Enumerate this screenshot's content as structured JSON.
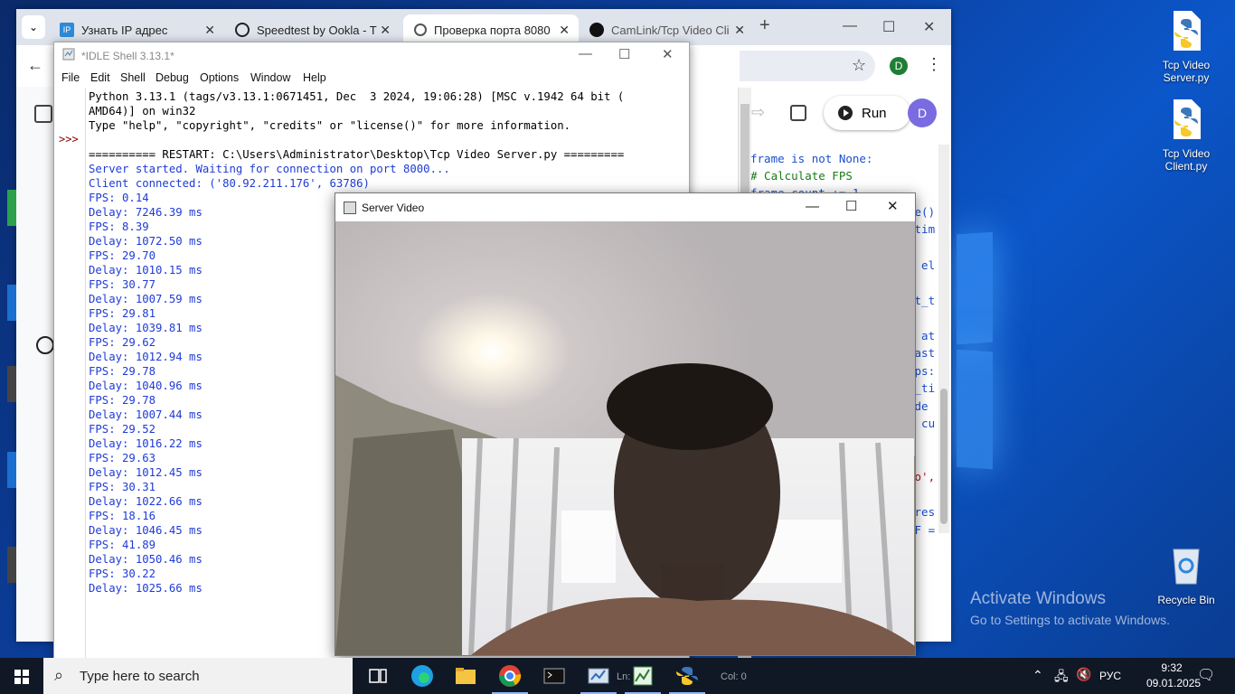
{
  "browser": {
    "tabs": [
      {
        "title": "Узнать IP адрес",
        "favicon": "ip-icon",
        "active": false
      },
      {
        "title": "Speedtest by Ookla - T",
        "favicon": "speedtest-icon",
        "active": false
      },
      {
        "title": "Проверка порта 8080",
        "favicon": "globe-icon",
        "active": true
      },
      {
        "title": "CamLink/Tcp Video Cli",
        "favicon": "github-icon",
        "active": false
      }
    ],
    "new_tab": "+",
    "profile_initial": "D",
    "run_label": "Run",
    "user_initial": "D",
    "code_lines": [
      {
        "text": "frame is not None:",
        "color": "#1a4fd1"
      },
      {
        "text": " # Calculate FPS",
        "color": "#1a7a1a"
      },
      {
        "text": "  frame_count += 1",
        "color": "#1a4fd1"
      },
      {
        "text": "ne()",
        "color": "#1a4fd1"
      },
      {
        "text": "_tim",
        "color": "#1a4fd1"
      },
      {
        "text": "/ el",
        "color": "#1a4fd1"
      },
      {
        "text": "nt_t",
        "color": "#1a4fd1"
      },
      {
        "text": "y at",
        "color": "#1a4fd1"
      },
      {
        "text": "last",
        "color": "#1a4fd1"
      },
      {
        "text": "fps:",
        "color": "#1a4fd1"
      },
      {
        "text": "d_ti",
        "color": "#1a4fd1"
      },
      {
        "text": "{de",
        "color": "#1a4fd1"
      },
      {
        "text": "= cu",
        "color": "#1a4fd1"
      },
      {
        "text": "eo',",
        "color": "#a3151d"
      },
      {
        "text": "pres",
        "color": "#1a4fd1"
      },
      {
        "text": "FF =",
        "color": "#1a4fd1"
      }
    ]
  },
  "idle": {
    "title": "*IDLE Shell 3.13.1*",
    "menu": [
      "File",
      "Edit",
      "Shell",
      "Debug",
      "Options",
      "Window",
      "Help"
    ],
    "prompt": ">>>",
    "lines": [
      {
        "text": "Python 3.13.1 (tags/v3.13.1:0671451, Dec  3 2024, 19:06:28) [MSC v.1942 64 bit (",
        "color": "#000000"
      },
      {
        "text": "AMD64)] on win32",
        "color": "#000000"
      },
      {
        "text": "Type \"help\", \"copyright\", \"credits\" or \"license()\" for more information.",
        "color": "#000000"
      },
      {
        "text": "",
        "color": "#000000"
      },
      {
        "text": "========== RESTART: C:\\Users\\Administrator\\Desktop\\Tcp Video Server.py =========",
        "color": "#000000"
      },
      {
        "text": "Server started. Waiting for connection on port 8000...",
        "color": "#1f3bd6"
      },
      {
        "text": "Client connected: ('80.92.211.176', 63786)",
        "color": "#1f3bd6"
      },
      {
        "text": "FPS: 0.14",
        "color": "#1f3bd6"
      },
      {
        "text": "Delay: 7246.39 ms",
        "color": "#1f3bd6"
      },
      {
        "text": "FPS: 8.39",
        "color": "#1f3bd6"
      },
      {
        "text": "Delay: 1072.50 ms",
        "color": "#1f3bd6"
      },
      {
        "text": "FPS: 29.70",
        "color": "#1f3bd6"
      },
      {
        "text": "Delay: 1010.15 ms",
        "color": "#1f3bd6"
      },
      {
        "text": "FPS: 30.77",
        "color": "#1f3bd6"
      },
      {
        "text": "Delay: 1007.59 ms",
        "color": "#1f3bd6"
      },
      {
        "text": "FPS: 29.81",
        "color": "#1f3bd6"
      },
      {
        "text": "Delay: 1039.81 ms",
        "color": "#1f3bd6"
      },
      {
        "text": "FPS: 29.62",
        "color": "#1f3bd6"
      },
      {
        "text": "Delay: 1012.94 ms",
        "color": "#1f3bd6"
      },
      {
        "text": "FPS: 29.78",
        "color": "#1f3bd6"
      },
      {
        "text": "Delay: 1040.96 ms",
        "color": "#1f3bd6"
      },
      {
        "text": "FPS: 29.78",
        "color": "#1f3bd6"
      },
      {
        "text": "Delay: 1007.44 ms",
        "color": "#1f3bd6"
      },
      {
        "text": "FPS: 29.52",
        "color": "#1f3bd6"
      },
      {
        "text": "Delay: 1016.22 ms",
        "color": "#1f3bd6"
      },
      {
        "text": "FPS: 29.63",
        "color": "#1f3bd6"
      },
      {
        "text": "Delay: 1012.45 ms",
        "color": "#1f3bd6"
      },
      {
        "text": "FPS: 30.31",
        "color": "#1f3bd6"
      },
      {
        "text": "Delay: 1022.66 ms",
        "color": "#1f3bd6"
      },
      {
        "text": "FPS: 18.16",
        "color": "#1f3bd6"
      },
      {
        "text": "Delay: 1046.45 ms",
        "color": "#1f3bd6"
      },
      {
        "text": "FPS: 41.89",
        "color": "#1f3bd6"
      },
      {
        "text": "Delay: 1050.46 ms",
        "color": "#1f3bd6"
      },
      {
        "text": "FPS: 30.22",
        "color": "#1f3bd6"
      },
      {
        "text": "Delay: 1025.66 ms",
        "color": "#1f3bd6"
      }
    ],
    "status_ln": "Ln:",
    "status_col": "Col: 0"
  },
  "video": {
    "title": "Server Video"
  },
  "desktop": {
    "icons": [
      {
        "label": "Tcp Video Server.py",
        "icon": "python-file-icon"
      },
      {
        "label": "Tcp Video Client.py",
        "icon": "python-file-icon"
      },
      {
        "label": "Recycle Bin",
        "icon": "recycle-bin-icon"
      }
    ],
    "activate_title": "Activate Windows",
    "activate_sub": "Go to Settings to activate Windows."
  },
  "taskbar": {
    "search_placeholder": "Type here to search",
    "lang": "РУС",
    "time": "9:32",
    "date": "09.01.2025",
    "apps": [
      "task-view-icon",
      "edge-icon",
      "file-explorer-icon",
      "chrome-icon",
      "terminal-icon",
      "control-panel-icon",
      "task-manager-icon",
      "python-idle-icon"
    ]
  },
  "colors": {
    "idle_output": "#1f3bd6",
    "prompt": "#8b0000",
    "taskbar": "#101826",
    "desktop": "#0b4bb5"
  }
}
